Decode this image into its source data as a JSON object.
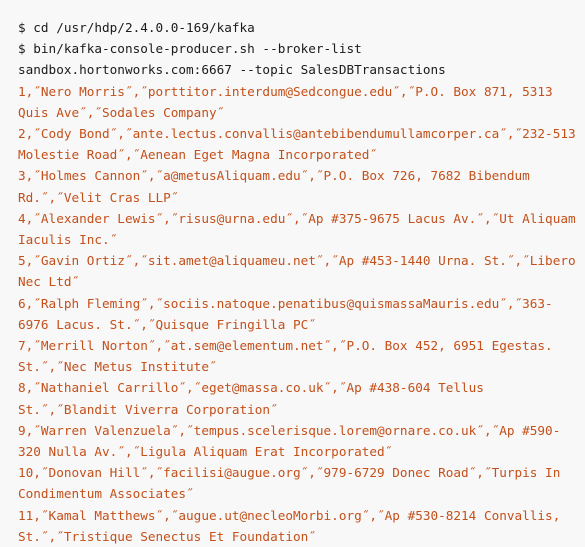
{
  "terminal": {
    "background_color": "#f8f8f8",
    "command_color": "#1b1b1b",
    "output_color": "#c4501a",
    "prompt_symbol": "$",
    "command_lines": [
      "$ cd /usr/hdp/2.4.0.0-169/kafka",
      "$ bin/kafka-console-producer.sh --broker-list sandbox.hortonworks.com:6667 --topic SalesDBTransactions"
    ],
    "output_lines": [
      "1,˝Nero Morris˝,˝porttitor.interdum@Sedcongue.edu˝,˝P.O. Box 871, 5313 Quis Ave˝,˝Sodales Company˝",
      "2,˝Cody Bond˝,˝ante.lectus.convallis@antebibendumullamcorper.ca˝,˝232-513 Molestie Road˝,˝Aenean Eget Magna Incorporated˝",
      "3,˝Holmes Cannon˝,˝a@metusAliquam.edu˝,˝P.O. Box 726, 7682 Bibendum Rd.˝,˝Velit Cras LLP˝",
      "4,˝Alexander Lewis˝,˝risus@urna.edu˝,˝Ap #375-9675 Lacus Av.˝,˝Ut Aliquam Iaculis Inc.˝",
      "5,˝Gavin Ortiz˝,˝sit.amet@aliquameu.net˝,˝Ap #453-1440 Urna. St.˝,˝Libero Nec Ltd˝",
      "6,˝Ralph Fleming˝,˝sociis.natoque.penatibus@quismassaMauris.edu˝,˝363-6976 Lacus. St.˝,˝Quisque Fringilla PC˝",
      "7,˝Merrill Norton˝,˝at.sem@elementum.net˝,˝P.O. Box 452, 6951 Egestas. St.˝,˝Nec Metus Institute˝",
      "8,˝Nathaniel Carrillo˝,˝eget@massa.co.uk˝,˝Ap #438-604 Tellus St.˝,˝Blandit Viverra Corporation˝",
      "9,˝Warren Valenzuela˝,˝tempus.scelerisque.lorem@ornare.co.uk˝,˝Ap #590-320 Nulla Av.˝,˝Ligula Aliquam Erat Incorporated˝",
      "10,˝Donovan Hill˝,˝facilisi@augue.org˝,˝979-6729 Donec Road˝,˝Turpis In Condimentum Associates˝",
      "11,˝Kamal Matthews˝,˝augue.ut@necleoMorbi.org˝,˝Ap #530-8214 Convallis, St.˝,˝Tristique Senectus Et Foundation˝"
    ],
    "records": [
      {
        "id": "1",
        "name": "Nero Morris",
        "email": "porttitor.interdum@Sedcongue.edu",
        "address": "P.O. Box 871, 5313 Quis Ave",
        "company": "Sodales Company"
      },
      {
        "id": "2",
        "name": "Cody Bond",
        "email": "ante.lectus.convallis@antebibendumullamcorper.ca",
        "address": "232-513 Molestie Road",
        "company": "Aenean Eget Magna Incorporated"
      },
      {
        "id": "3",
        "name": "Holmes Cannon",
        "email": "a@metusAliquam.edu",
        "address": "P.O. Box 726, 7682 Bibendum Rd.",
        "company": "Velit Cras LLP"
      },
      {
        "id": "4",
        "name": "Alexander Lewis",
        "email": "risus@urna.edu",
        "address": "Ap #375-9675 Lacus Av.",
        "company": "Ut Aliquam Iaculis Inc."
      },
      {
        "id": "5",
        "name": "Gavin Ortiz",
        "email": "sit.amet@aliquameu.net",
        "address": "Ap #453-1440 Urna. St.",
        "company": "Libero Nec Ltd"
      },
      {
        "id": "6",
        "name": "Ralph Fleming",
        "email": "sociis.natoque.penatibus@quismassaMauris.edu",
        "address": "363-6976 Lacus. St.",
        "company": "Quisque Fringilla PC"
      },
      {
        "id": "7",
        "name": "Merrill Norton",
        "email": "at.sem@elementum.net",
        "address": "P.O. Box 452, 6951 Egestas. St.",
        "company": "Nec Metus Institute"
      },
      {
        "id": "8",
        "name": "Nathaniel Carrillo",
        "email": "eget@massa.co.uk",
        "address": "Ap #438-604 Tellus St.",
        "company": "Blandit Viverra Corporation"
      },
      {
        "id": "9",
        "name": "Warren Valenzuela",
        "email": "tempus.scelerisque.lorem@ornare.co.uk",
        "address": "Ap #590-320 Nulla Av.",
        "company": "Ligula Aliquam Erat Incorporated"
      },
      {
        "id": "10",
        "name": "Donovan Hill",
        "email": "facilisi@augue.org",
        "address": "979-6729 Donec Road",
        "company": "Turpis In Condimentum Associates"
      },
      {
        "id": "11",
        "name": "Kamal Matthews",
        "email": "augue.ut@necleoMorbi.org",
        "address": "Ap #530-8214 Convallis, St.",
        "company": "Tristique Senectus Et Foundation"
      }
    ]
  }
}
